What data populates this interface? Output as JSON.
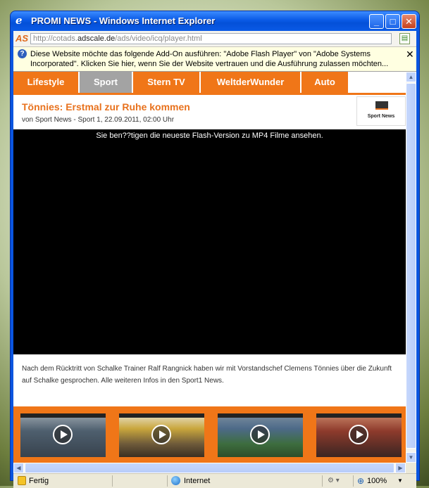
{
  "window": {
    "title": "PROMI NEWS - Windows Internet Explorer",
    "icon": "ie-icon",
    "buttons": {
      "minimize": "_",
      "maximize": "□",
      "close": "✕"
    }
  },
  "addressbar": {
    "logo": "AS",
    "url_prefix": "http://cotads.",
    "url_domain": "adscale.de",
    "url_suffix": "/ads/video/icq/player.html"
  },
  "infobar": {
    "text": "Diese Website möchte das folgende Add-On ausführen: \"Adobe Flash Player\" von \"Adobe Systems Incorporated\". Klicken Sie hier, wenn Sie der Website vertrauen und die Ausführung zulassen möchten...",
    "close": "✕"
  },
  "nav": {
    "tabs": [
      {
        "label": "Lifestyle",
        "active": false
      },
      {
        "label": "Sport",
        "active": true
      },
      {
        "label": "Stern TV",
        "active": false
      },
      {
        "label": "WeltderWunder",
        "active": false
      },
      {
        "label": "Auto",
        "active": false
      }
    ]
  },
  "article": {
    "headline": "Tönnies: Erstmal zur Ruhe kommen",
    "meta": "von Sport News - Sport 1, 22.09.2011, 02:00 Uhr",
    "logo_label": "Sport News",
    "flash_message": "Sie ben??tigen die neueste Flash-Version zu MP4 Filme ansehen.",
    "description": "Nach dem Rücktritt von Schalke Trainer Ralf Rangnick haben wir mit Vorstandschef Clemens Tönnies über die Zukunft auf Schalke gesprochen. Alle weiteren Infos in den Sport1 News."
  },
  "thumbnails": [
    {
      "name": "video-thumb-1"
    },
    {
      "name": "video-thumb-2"
    },
    {
      "name": "video-thumb-3"
    },
    {
      "name": "video-thumb-4"
    }
  ],
  "statusbar": {
    "status": "Fertig",
    "zone": "Internet",
    "zoom": "100%"
  },
  "colors": {
    "accent": "#f07618",
    "active_tab": "#a3a3a3",
    "headline": "#e8721e"
  }
}
